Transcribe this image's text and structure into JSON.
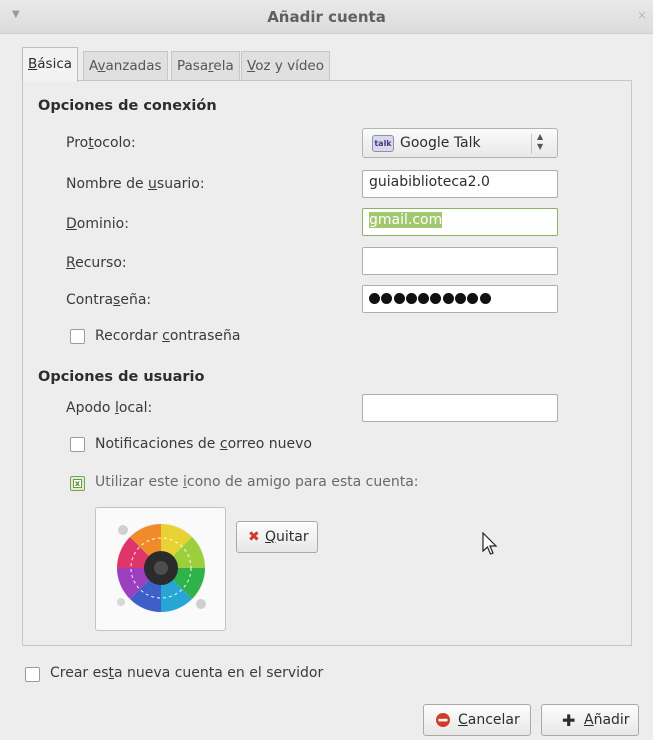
{
  "window": {
    "title": "Añadir cuenta",
    "menu_icon": "chevron-down-icon",
    "close_glyph": "×"
  },
  "tabs": [
    {
      "pre": "",
      "acc": "B",
      "post": "ásica",
      "active": true
    },
    {
      "pre": "A",
      "acc": "v",
      "post": "anzadas",
      "active": false
    },
    {
      "pre": "Pasa",
      "acc": "r",
      "post": "ela",
      "active": false
    },
    {
      "pre": "",
      "acc": "V",
      "post": "oz y vídeo",
      "active": false
    }
  ],
  "connection": {
    "section_title": "Opciones de conexión",
    "protocol": {
      "pre": "Pro",
      "acc": "t",
      "post": "ocolo:",
      "value": "Google Talk",
      "icon_text": "talk"
    },
    "username": {
      "pre": "Nombre de ",
      "acc": "u",
      "post": "suario:",
      "value": "guiabiblioteca2.0"
    },
    "domain": {
      "pre": "",
      "acc": "D",
      "post": "ominio:",
      "value": "gmail.com"
    },
    "resource": {
      "pre": "",
      "acc": "R",
      "post": "ecurso:",
      "value": ""
    },
    "password": {
      "pre": "Contra",
      "acc": "s",
      "post": "eña:",
      "dots": 10
    },
    "remember": {
      "pre": "Recordar ",
      "acc": "c",
      "post": "ontraseña",
      "checked": false
    }
  },
  "user": {
    "section_title": "Opciones de usuario",
    "alias": {
      "pre": "Apodo ",
      "acc": "l",
      "post": "ocal:",
      "value": ""
    },
    "mail_notify": {
      "pre": "Notificaciones de ",
      "acc": "c",
      "post": "orreo nuevo",
      "checked": false
    },
    "buddy_icon": {
      "pre": "Utilizar este ",
      "acc": "i",
      "post": "cono de amigo para esta cuenta:",
      "checked": true
    },
    "remove_button": {
      "acc": "Q",
      "post": "uitar",
      "icon": "close-icon"
    }
  },
  "create_on_server": {
    "pre": "Crear es",
    "acc": "t",
    "post": "a nueva cuenta en el servidor",
    "checked": false
  },
  "buttons": {
    "cancel": {
      "acc": "C",
      "post": "ancelar",
      "icon": "cancel-icon"
    },
    "add": {
      "acc": "A",
      "post": "ñadir",
      "icon": "plus-icon"
    }
  },
  "colors": {
    "accent_green": "#a1c76f",
    "cancel_red": "#d23b2a"
  }
}
